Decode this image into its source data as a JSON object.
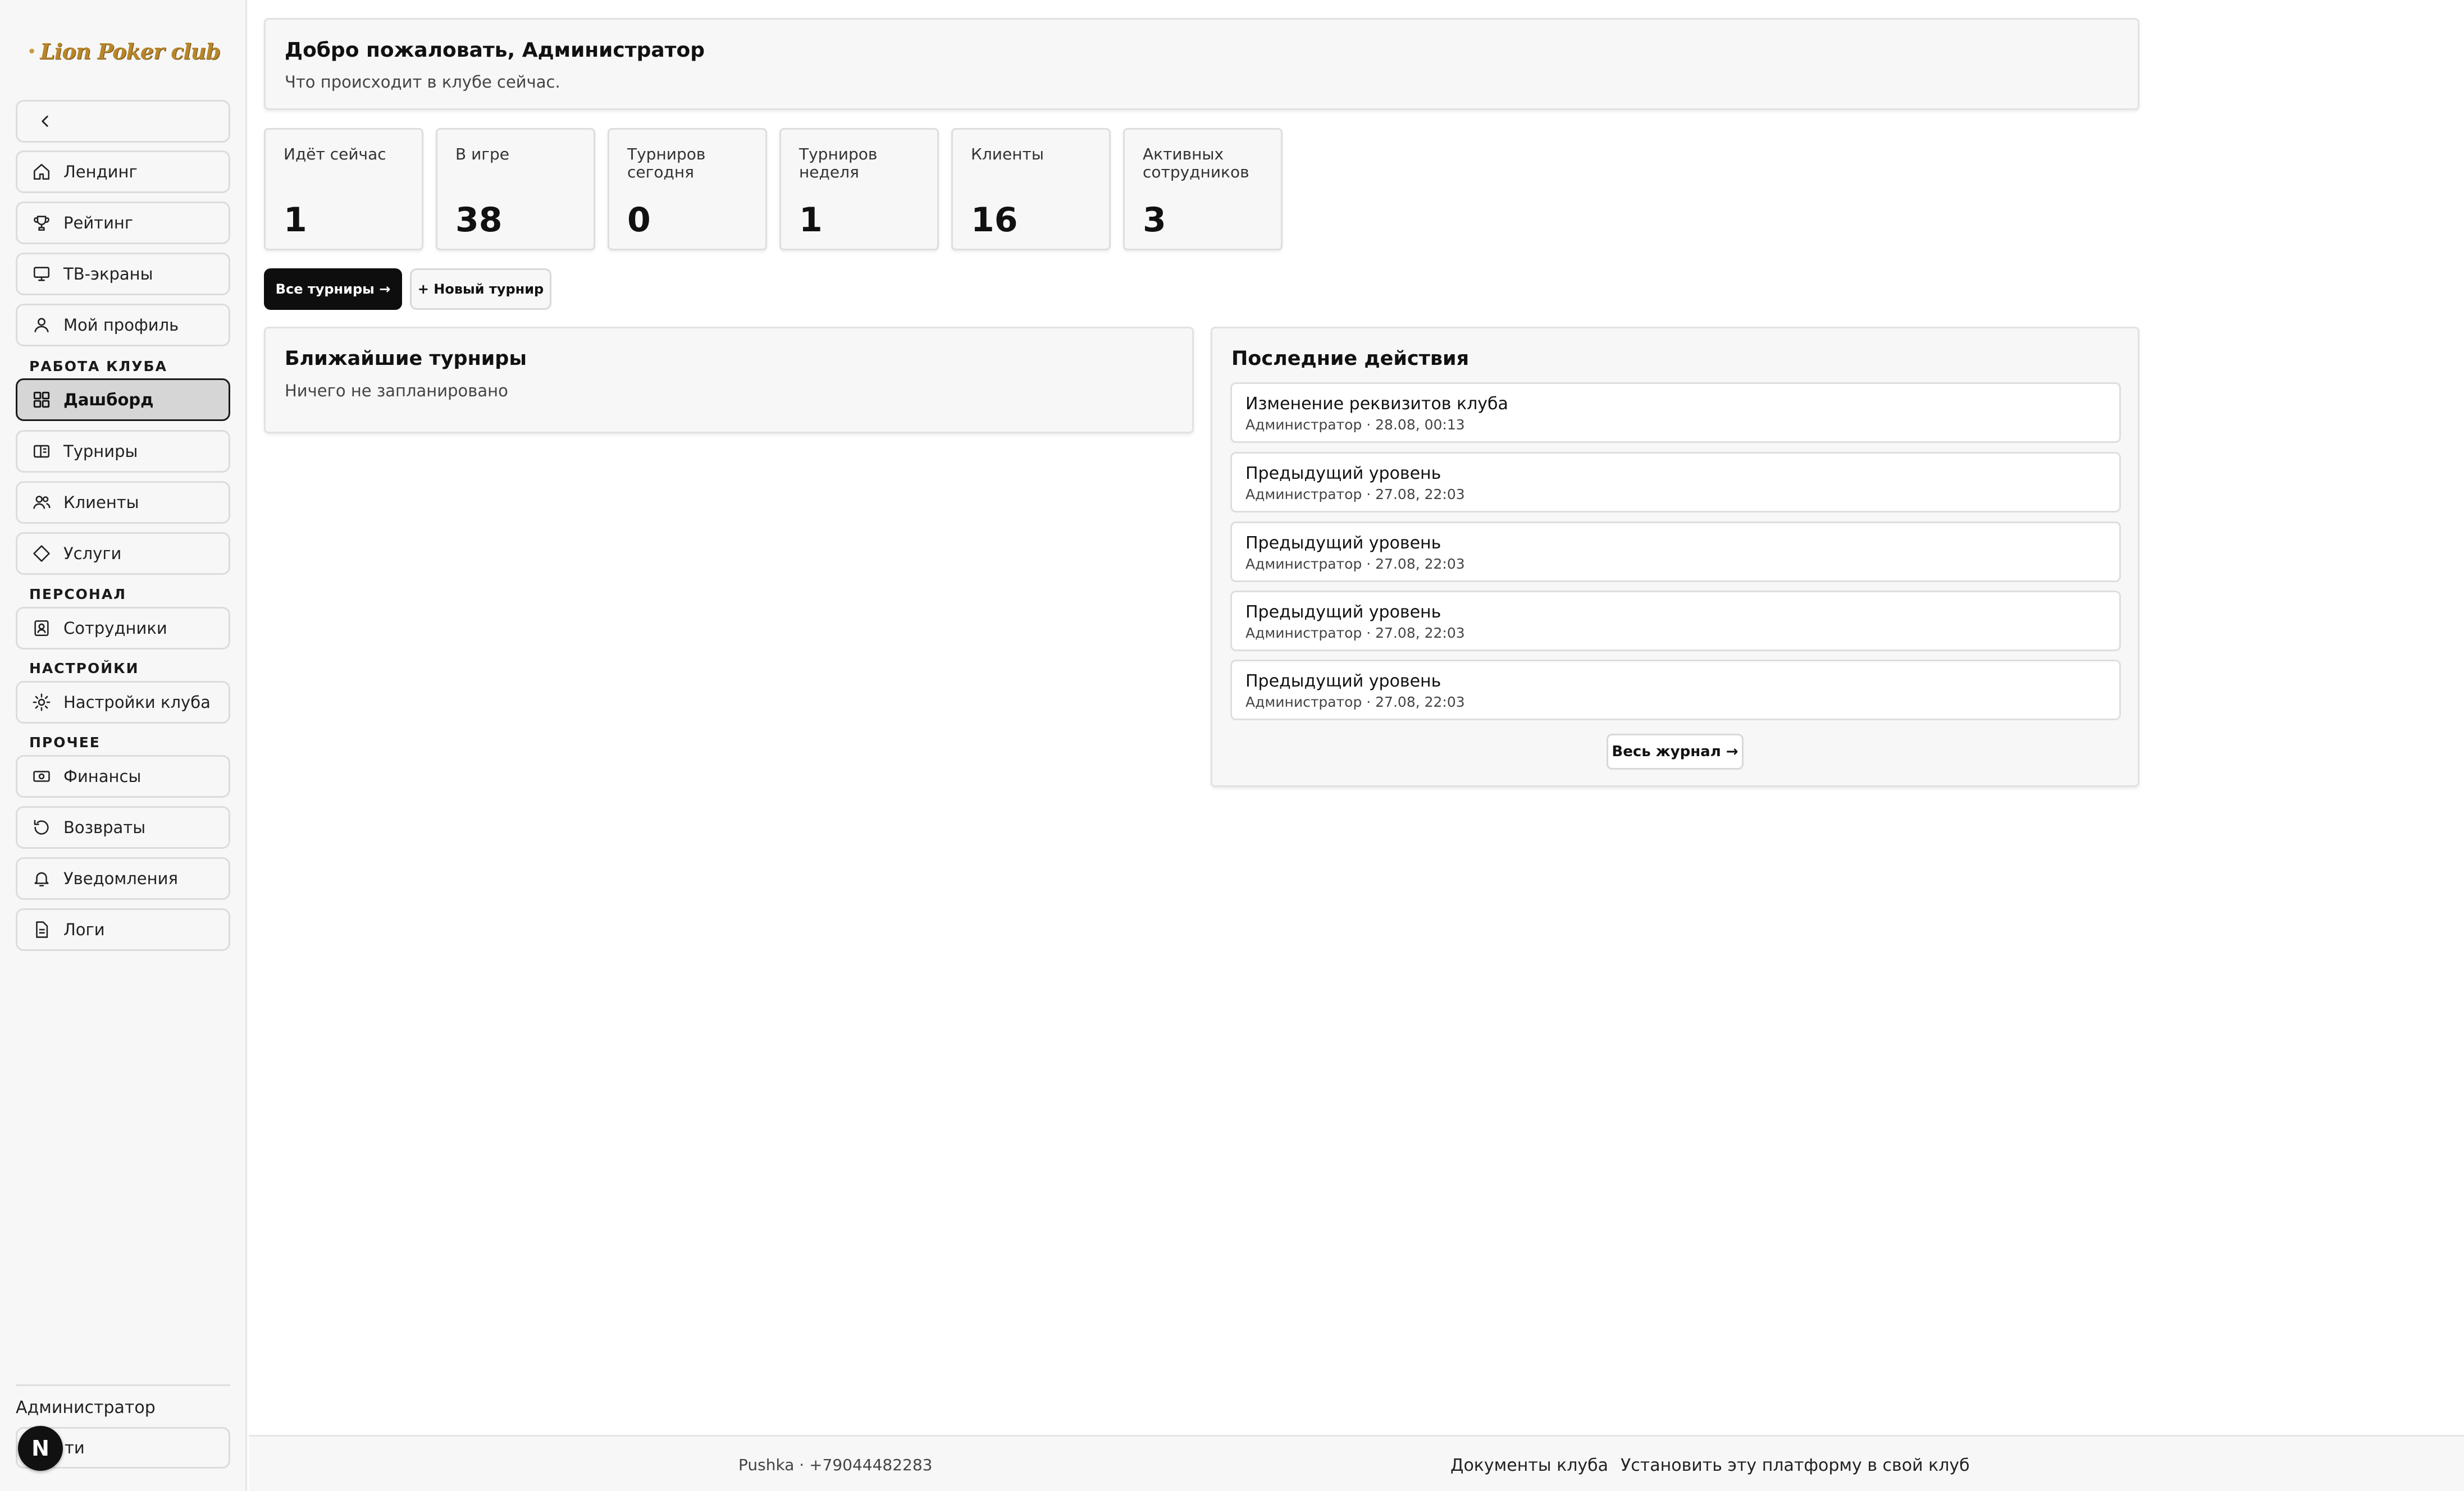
{
  "brand": {
    "logo_text": "Lion Poker club"
  },
  "sidebar": {
    "collapse_icon": "chevron-left-icon",
    "items_top": [
      {
        "label": "Лендинг",
        "icon": "home-icon"
      },
      {
        "label": "Рейтинг",
        "icon": "trophy-icon"
      },
      {
        "label": "ТВ-экраны",
        "icon": "monitor-icon"
      },
      {
        "label": "Мой профиль",
        "icon": "user-icon"
      }
    ],
    "sections": {
      "club_work": "РАБОТА КЛУБА",
      "staff": "ПЕРСОНАЛ",
      "settings": "НАСТРОЙКИ",
      "other": "ПРОЧЕЕ"
    },
    "items_club": [
      {
        "label": "Дашборд",
        "icon": "grid-icon",
        "active": true
      },
      {
        "label": "Турниры",
        "icon": "ticket-icon"
      },
      {
        "label": "Клиенты",
        "icon": "users-icon"
      },
      {
        "label": "Услуги",
        "icon": "diamond-icon"
      }
    ],
    "items_staff": [
      {
        "label": "Сотрудники",
        "icon": "badge-icon"
      }
    ],
    "items_settings": [
      {
        "label": "Настройки клуба",
        "icon": "sun-gear-icon"
      }
    ],
    "items_other": [
      {
        "label": "Финансы",
        "icon": "banknote-icon"
      },
      {
        "label": "Возвраты",
        "icon": "refund-icon"
      },
      {
        "label": "Уведомления",
        "icon": "bell-icon"
      },
      {
        "label": "Логи",
        "icon": "file-icon"
      }
    ],
    "user_name": "Администратор",
    "logout_label": "ти",
    "badge_letter": "N"
  },
  "welcome": {
    "title": "Добро пожаловать, Администратор",
    "subtitle": "Что происходит в клубе сейчас."
  },
  "stats": [
    {
      "label": "Идёт сейчас",
      "value": "1"
    },
    {
      "label": "В игре",
      "value": "38"
    },
    {
      "label": "Турниров сегодня",
      "value": "0"
    },
    {
      "label": "Турниров неделя",
      "value": "1"
    },
    {
      "label": "Клиенты",
      "value": "16"
    },
    {
      "label": "Активных сотрудников",
      "value": "3"
    }
  ],
  "actions": {
    "all_tournaments": "Все турниры →",
    "new_tournament": "+ Новый турнир"
  },
  "upcoming": {
    "title": "Ближайшие турниры",
    "empty": "Ничего не запланировано"
  },
  "recent": {
    "title": "Последние действия",
    "items": [
      {
        "title": "Изменение реквизитов клуба",
        "meta": "Администратор · 28.08, 00:13"
      },
      {
        "title": "Предыдущий уровень",
        "meta": "Администратор · 27.08, 22:03"
      },
      {
        "title": "Предыдущий уровень",
        "meta": "Администратор · 27.08, 22:03"
      },
      {
        "title": "Предыдущий уровень",
        "meta": "Администратор · 27.08, 22:03"
      },
      {
        "title": "Предыдущий уровень",
        "meta": "Администратор · 27.08, 22:03"
      }
    ],
    "full_log": "Весь журнал →"
  },
  "footer": {
    "contact": "Pushka · +79044482283",
    "docs": "Документы клуба",
    "install": "Установить эту платформу в свой клуб"
  }
}
